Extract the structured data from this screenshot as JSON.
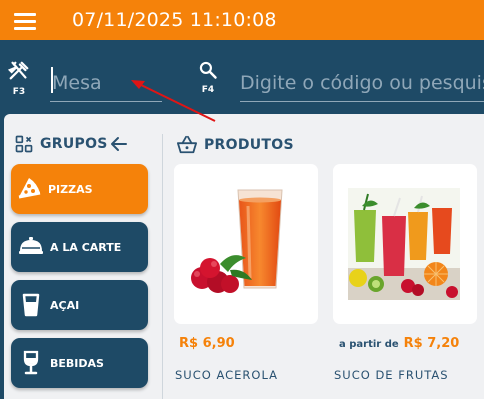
{
  "header": {
    "datetime": "07/11/2025 11:10:08"
  },
  "search": {
    "mesa_shortcut": "F3",
    "mesa_placeholder": "Mesa",
    "code_shortcut": "F4",
    "code_placeholder": "Digite o código ou pesquisa"
  },
  "groups": {
    "title": "GRUPOS",
    "items": [
      {
        "label": "PIZZAS",
        "icon": "pizza-icon",
        "active": true
      },
      {
        "label": "A LA CARTE",
        "icon": "cloche-icon",
        "active": false
      },
      {
        "label": "AÇAI",
        "icon": "cup-icon",
        "active": false
      },
      {
        "label": "BEBIDAS",
        "icon": "wine-glass-icon",
        "active": false
      }
    ]
  },
  "products": {
    "title": "PRODUTOS",
    "items": [
      {
        "name": "SUCO ACEROLA",
        "price_prefix": "",
        "price": "R$ 6,90"
      },
      {
        "name": "SUCO DE FRUTAS",
        "price_prefix": "a partir de",
        "price": "R$ 7,20"
      }
    ]
  },
  "colors": {
    "accent": "#f5820a",
    "primary": "#1e4a66",
    "background": "#f0f1f3"
  }
}
